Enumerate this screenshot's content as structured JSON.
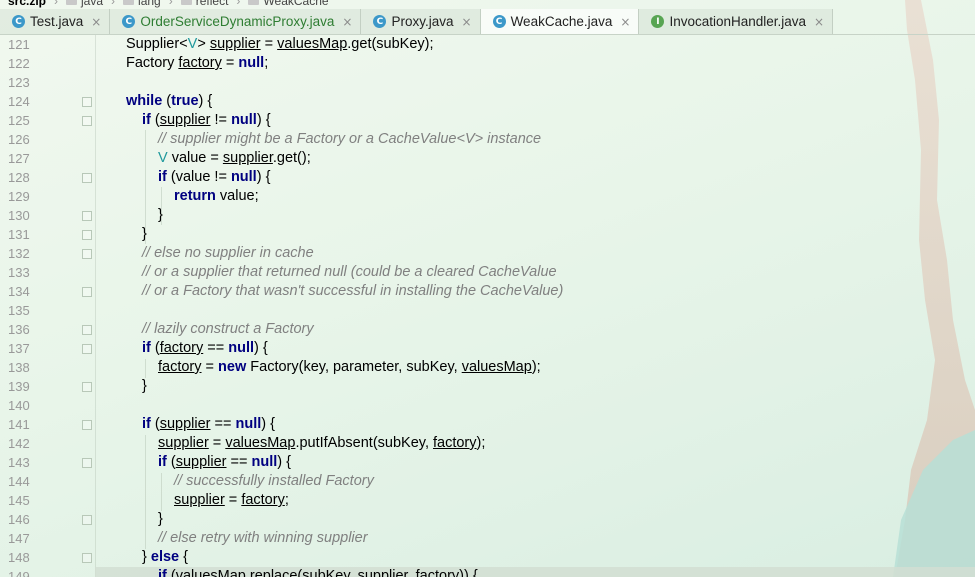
{
  "breadcrumb": [
    {
      "label": "src.zip"
    },
    {
      "label": "java"
    },
    {
      "label": "lang"
    },
    {
      "label": "reflect"
    },
    {
      "label": "WeakCache"
    }
  ],
  "tabs": [
    {
      "label": "Test.java",
      "icon": "class-icon",
      "active": false
    },
    {
      "label": "OrderServiceDynamicProxy.java",
      "icon": "class-icon",
      "active": false
    },
    {
      "label": "Proxy.java",
      "icon": "class-icon",
      "active": false
    },
    {
      "label": "WeakCache.java",
      "icon": "class-icon",
      "active": true
    },
    {
      "label": "InvocationHandler.java",
      "icon": "interface-icon",
      "active": false
    }
  ],
  "editor": {
    "lines": [
      {
        "n": "121",
        "fold": false
      },
      {
        "n": "122",
        "fold": false
      },
      {
        "n": "123",
        "fold": false
      },
      {
        "n": "124",
        "fold": true
      },
      {
        "n": "125",
        "fold": true
      },
      {
        "n": "126",
        "fold": false
      },
      {
        "n": "127",
        "fold": false
      },
      {
        "n": "128",
        "fold": true
      },
      {
        "n": "129",
        "fold": false
      },
      {
        "n": "130",
        "fold": true
      },
      {
        "n": "131",
        "fold": true
      },
      {
        "n": "132",
        "fold": true
      },
      {
        "n": "133",
        "fold": false
      },
      {
        "n": "134",
        "fold": true
      },
      {
        "n": "135",
        "fold": false
      },
      {
        "n": "136",
        "fold": true
      },
      {
        "n": "137",
        "fold": true
      },
      {
        "n": "138",
        "fold": false
      },
      {
        "n": "139",
        "fold": true
      },
      {
        "n": "140",
        "fold": false
      },
      {
        "n": "141",
        "fold": true
      },
      {
        "n": "142",
        "fold": false
      },
      {
        "n": "143",
        "fold": true
      },
      {
        "n": "144",
        "fold": false
      },
      {
        "n": "145",
        "fold": false
      },
      {
        "n": "146",
        "fold": true
      },
      {
        "n": "147",
        "fold": false
      },
      {
        "n": "148",
        "fold": true
      },
      {
        "n": "149",
        "fold": false
      }
    ]
  },
  "code": {
    "l121": [
      "Supplier<",
      "V",
      "> ",
      "supplier",
      " = ",
      "valuesMap",
      ".get(subKey);"
    ],
    "l122": [
      "Factory ",
      "factory",
      " = ",
      "null",
      ";"
    ],
    "l124": [
      "while",
      " (",
      "true",
      ") {"
    ],
    "l125": [
      "if",
      " (",
      "supplier",
      " != ",
      "null",
      ") {"
    ],
    "l126": [
      "// supplier might be a Factory or a CacheValue<V> instance"
    ],
    "l127": [
      "V",
      " value = ",
      "supplier",
      ".get();"
    ],
    "l128": [
      "if",
      " (value != ",
      "null",
      ") {"
    ],
    "l129": [
      "return",
      " value;"
    ],
    "l130": [
      "}"
    ],
    "l131": [
      "}"
    ],
    "l132": [
      "// else no supplier in cache"
    ],
    "l133": [
      "// or a supplier that returned null (could be a cleared CacheValue"
    ],
    "l134": [
      "// or a Factory that wasn't successful in installing the CacheValue)"
    ],
    "l136": [
      "// lazily construct a Factory"
    ],
    "l137": [
      "if",
      " (",
      "factory",
      " == ",
      "null",
      ") {"
    ],
    "l138": [
      "factory",
      " = ",
      "new",
      " Factory(key, parameter, subKey, ",
      "valuesMap",
      ");"
    ],
    "l139": [
      "}"
    ],
    "l141": [
      "if",
      " (",
      "supplier",
      " == ",
      "null",
      ") {"
    ],
    "l142": [
      "supplier",
      " = ",
      "valuesMap",
      ".putIfAbsent(subKey, ",
      "factory",
      ");"
    ],
    "l143": [
      "if",
      " (",
      "supplier",
      " == ",
      "null",
      ") {"
    ],
    "l144": [
      "// successfully installed Factory"
    ],
    "l145": [
      "supplier",
      " = ",
      "factory",
      ";"
    ],
    "l146": [
      "}"
    ],
    "l147": [
      "// else retry with winning supplier"
    ],
    "l148": [
      "} ",
      "else",
      " {"
    ],
    "l149": [
      "if",
      " (",
      "valuesMap",
      ".replace(subKey, ",
      "supplier",
      ", ",
      "factory",
      ")) {"
    ]
  },
  "colors": {
    "keyword": "#000080",
    "comment": "#808080",
    "type_param": "#20999d",
    "line_number": "#999999",
    "tab_icon_class": "#3c98c9",
    "tab_icon_interface": "#58a553"
  }
}
